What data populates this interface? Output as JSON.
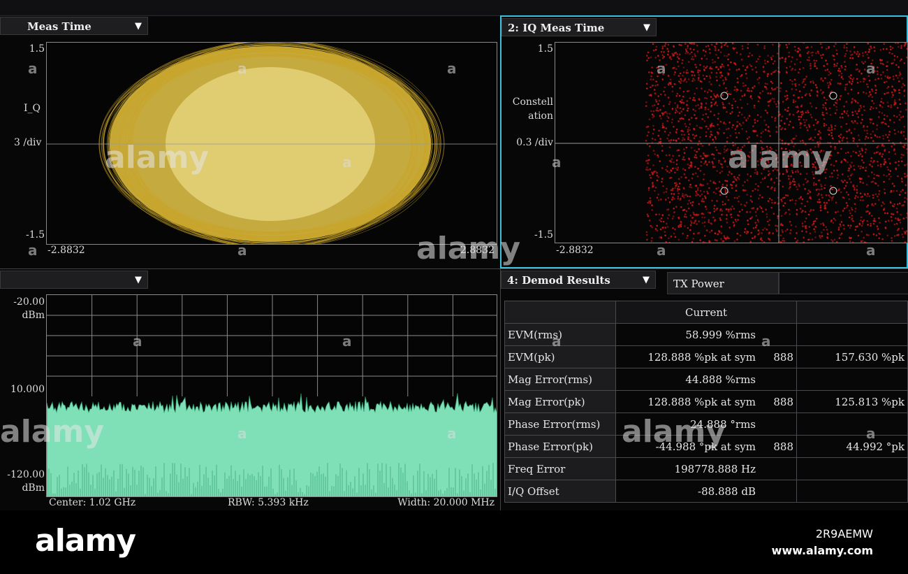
{
  "panels": {
    "iq_time": {
      "title": "Meas Time",
      "y_top": "1.5",
      "y_trace": "I_Q",
      "y_scale": "3 /div",
      "y_bottom": "-1.5",
      "x_left": "-2.8832",
      "x_right": "2.8832"
    },
    "constellation": {
      "title": "2: IQ Meas Time",
      "y_top": "1.5",
      "y_trace_line1": "Constell",
      "y_trace_line2": "ation",
      "y_scale": "0.3 /div",
      "y_bottom": "-1.5",
      "x_left": "-2.8832"
    },
    "spectrum": {
      "title": "",
      "ref_value": "-20.00",
      "ref_unit": "dBm",
      "mid_value": "10.000",
      "bottom_value": "-120.00",
      "bottom_unit": "dBm",
      "center": "Center: 1.02 GHz",
      "rbw": "RBW: 5.393 kHz",
      "width": "Width: 20.000 MHz"
    },
    "demod": {
      "title": "4: Demod Results",
      "tab": "TX Power",
      "header_current": "Current",
      "rows": [
        {
          "label": "EVM(rms)",
          "current": "58.999 %rms",
          "sym": "",
          "peak": ""
        },
        {
          "label": "EVM(pk)",
          "current": "128.888 %pk at sym",
          "sym": "888",
          "peak": "157.630 %pk"
        },
        {
          "label": "Mag Error(rms)",
          "current": "44.888 %rms",
          "sym": "",
          "peak": ""
        },
        {
          "label": "Mag Error(pk)",
          "current": "128.888 %pk at sym",
          "sym": "888",
          "peak": "125.813 %pk"
        },
        {
          "label": "Phase Error(rms)",
          "current": "24.888 °rms",
          "sym": "",
          "peak": ""
        },
        {
          "label": "Phase Error(pk)",
          "current": "-44.988 °pk at sym",
          "sym": "888",
          "peak": "44.992 °pk"
        },
        {
          "label": "Freq Error",
          "current": "198778.888 Hz",
          "sym": "",
          "peak": ""
        },
        {
          "label": "I/Q Offset",
          "current": "-88.888 dB",
          "sym": "",
          "peak": ""
        }
      ]
    }
  },
  "watermark": {
    "word": "alamy",
    "glyph": "a",
    "footer_logo": "alamy",
    "code": "2R9AEMW",
    "site": "www.alamy.com"
  },
  "colors": {
    "iq_trace": "#e8c84a",
    "constellation": "#d41818",
    "spectrum": "#7fe0b8",
    "active_border": "#37c2e0"
  },
  "icons": {
    "dropdown": "▼"
  }
}
